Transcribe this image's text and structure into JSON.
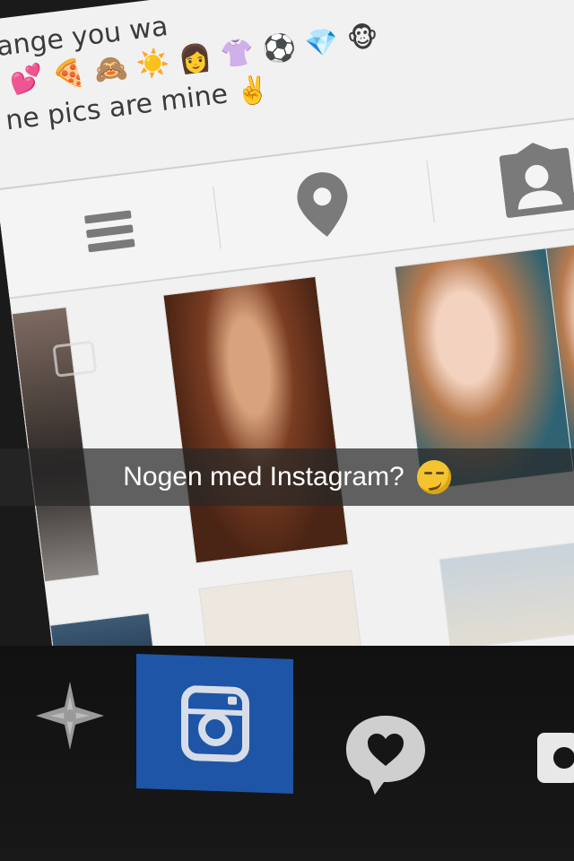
{
  "profile": {
    "bio_line_1": "ange you wa",
    "bio_emojis_1": [
      "💕",
      "🍕",
      "🙈",
      "☀️",
      "👩",
      "👚",
      "⚽",
      "💎",
      "🐵"
    ],
    "bio_line_2": "ne pics are mine",
    "bio_emoji_2": "✌️"
  },
  "tabs": {
    "list_icon": "list-icon",
    "map_icon": "map-pin-icon",
    "tagged_icon": "tagged-user-icon"
  },
  "caption": {
    "text": "Nogen med Instagram?"
  },
  "bottom_nav": {
    "explore_icon": "compass-star-icon",
    "instagram_icon": "instagram-icon",
    "messages_icon": "chat-heart-icon",
    "camera_icon": "camera-icon"
  },
  "colors": {
    "instagram_blue": "#1e55a6",
    "tab_icon_gray": "#7a7a7a",
    "caption_bg": "#282828"
  }
}
